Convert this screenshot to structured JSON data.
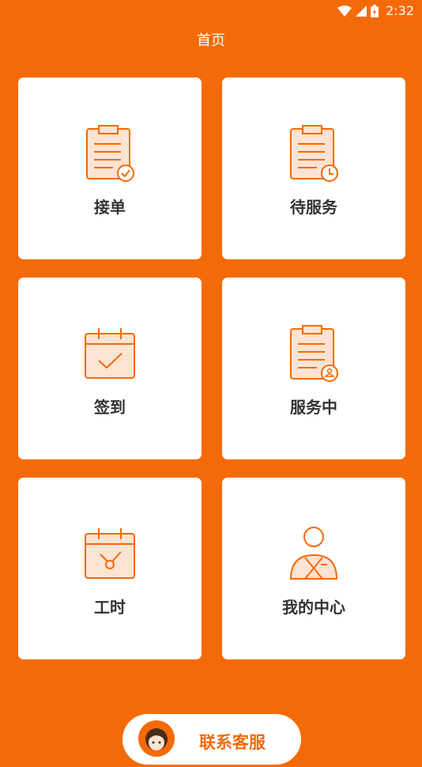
{
  "status_bar": {
    "time": "2:32",
    "icons": [
      "wifi-icon",
      "signal-icon",
      "battery-icon"
    ]
  },
  "header": {
    "title": "首页"
  },
  "menu": [
    {
      "label": "接单",
      "icon": "clipboard-check-icon"
    },
    {
      "label": "待服务",
      "icon": "clipboard-clock-icon"
    },
    {
      "label": "签到",
      "icon": "calendar-check-icon"
    },
    {
      "label": "服务中",
      "icon": "clipboard-person-icon"
    },
    {
      "label": "工时",
      "icon": "calendar-clock-icon"
    },
    {
      "label": "我的中心",
      "icon": "user-icon"
    }
  ],
  "service": {
    "label": "联系客服",
    "icon": "customer-service-avatar-icon"
  },
  "colors": {
    "brand": "#F56A08",
    "icon_fill": "#FDE3D2",
    "text": "#333333"
  }
}
